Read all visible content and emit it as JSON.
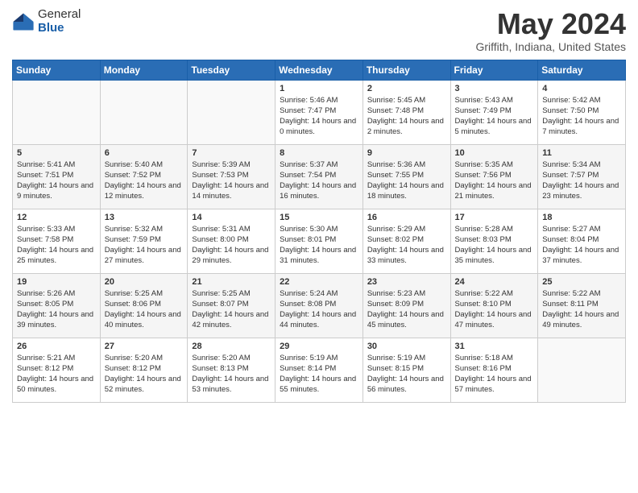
{
  "logo": {
    "general": "General",
    "blue": "Blue"
  },
  "title": "May 2024",
  "subtitle": "Griffith, Indiana, United States",
  "days_header": [
    "Sunday",
    "Monday",
    "Tuesday",
    "Wednesday",
    "Thursday",
    "Friday",
    "Saturday"
  ],
  "weeks": [
    [
      {
        "day": "",
        "sunrise": "",
        "sunset": "",
        "daylight": ""
      },
      {
        "day": "",
        "sunrise": "",
        "sunset": "",
        "daylight": ""
      },
      {
        "day": "",
        "sunrise": "",
        "sunset": "",
        "daylight": ""
      },
      {
        "day": "1",
        "sunrise": "Sunrise: 5:46 AM",
        "sunset": "Sunset: 7:47 PM",
        "daylight": "Daylight: 14 hours and 0 minutes."
      },
      {
        "day": "2",
        "sunrise": "Sunrise: 5:45 AM",
        "sunset": "Sunset: 7:48 PM",
        "daylight": "Daylight: 14 hours and 2 minutes."
      },
      {
        "day": "3",
        "sunrise": "Sunrise: 5:43 AM",
        "sunset": "Sunset: 7:49 PM",
        "daylight": "Daylight: 14 hours and 5 minutes."
      },
      {
        "day": "4",
        "sunrise": "Sunrise: 5:42 AM",
        "sunset": "Sunset: 7:50 PM",
        "daylight": "Daylight: 14 hours and 7 minutes."
      }
    ],
    [
      {
        "day": "5",
        "sunrise": "Sunrise: 5:41 AM",
        "sunset": "Sunset: 7:51 PM",
        "daylight": "Daylight: 14 hours and 9 minutes."
      },
      {
        "day": "6",
        "sunrise": "Sunrise: 5:40 AM",
        "sunset": "Sunset: 7:52 PM",
        "daylight": "Daylight: 14 hours and 12 minutes."
      },
      {
        "day": "7",
        "sunrise": "Sunrise: 5:39 AM",
        "sunset": "Sunset: 7:53 PM",
        "daylight": "Daylight: 14 hours and 14 minutes."
      },
      {
        "day": "8",
        "sunrise": "Sunrise: 5:37 AM",
        "sunset": "Sunset: 7:54 PM",
        "daylight": "Daylight: 14 hours and 16 minutes."
      },
      {
        "day": "9",
        "sunrise": "Sunrise: 5:36 AM",
        "sunset": "Sunset: 7:55 PM",
        "daylight": "Daylight: 14 hours and 18 minutes."
      },
      {
        "day": "10",
        "sunrise": "Sunrise: 5:35 AM",
        "sunset": "Sunset: 7:56 PM",
        "daylight": "Daylight: 14 hours and 21 minutes."
      },
      {
        "day": "11",
        "sunrise": "Sunrise: 5:34 AM",
        "sunset": "Sunset: 7:57 PM",
        "daylight": "Daylight: 14 hours and 23 minutes."
      }
    ],
    [
      {
        "day": "12",
        "sunrise": "Sunrise: 5:33 AM",
        "sunset": "Sunset: 7:58 PM",
        "daylight": "Daylight: 14 hours and 25 minutes."
      },
      {
        "day": "13",
        "sunrise": "Sunrise: 5:32 AM",
        "sunset": "Sunset: 7:59 PM",
        "daylight": "Daylight: 14 hours and 27 minutes."
      },
      {
        "day": "14",
        "sunrise": "Sunrise: 5:31 AM",
        "sunset": "Sunset: 8:00 PM",
        "daylight": "Daylight: 14 hours and 29 minutes."
      },
      {
        "day": "15",
        "sunrise": "Sunrise: 5:30 AM",
        "sunset": "Sunset: 8:01 PM",
        "daylight": "Daylight: 14 hours and 31 minutes."
      },
      {
        "day": "16",
        "sunrise": "Sunrise: 5:29 AM",
        "sunset": "Sunset: 8:02 PM",
        "daylight": "Daylight: 14 hours and 33 minutes."
      },
      {
        "day": "17",
        "sunrise": "Sunrise: 5:28 AM",
        "sunset": "Sunset: 8:03 PM",
        "daylight": "Daylight: 14 hours and 35 minutes."
      },
      {
        "day": "18",
        "sunrise": "Sunrise: 5:27 AM",
        "sunset": "Sunset: 8:04 PM",
        "daylight": "Daylight: 14 hours and 37 minutes."
      }
    ],
    [
      {
        "day": "19",
        "sunrise": "Sunrise: 5:26 AM",
        "sunset": "Sunset: 8:05 PM",
        "daylight": "Daylight: 14 hours and 39 minutes."
      },
      {
        "day": "20",
        "sunrise": "Sunrise: 5:25 AM",
        "sunset": "Sunset: 8:06 PM",
        "daylight": "Daylight: 14 hours and 40 minutes."
      },
      {
        "day": "21",
        "sunrise": "Sunrise: 5:25 AM",
        "sunset": "Sunset: 8:07 PM",
        "daylight": "Daylight: 14 hours and 42 minutes."
      },
      {
        "day": "22",
        "sunrise": "Sunrise: 5:24 AM",
        "sunset": "Sunset: 8:08 PM",
        "daylight": "Daylight: 14 hours and 44 minutes."
      },
      {
        "day": "23",
        "sunrise": "Sunrise: 5:23 AM",
        "sunset": "Sunset: 8:09 PM",
        "daylight": "Daylight: 14 hours and 45 minutes."
      },
      {
        "day": "24",
        "sunrise": "Sunrise: 5:22 AM",
        "sunset": "Sunset: 8:10 PM",
        "daylight": "Daylight: 14 hours and 47 minutes."
      },
      {
        "day": "25",
        "sunrise": "Sunrise: 5:22 AM",
        "sunset": "Sunset: 8:11 PM",
        "daylight": "Daylight: 14 hours and 49 minutes."
      }
    ],
    [
      {
        "day": "26",
        "sunrise": "Sunrise: 5:21 AM",
        "sunset": "Sunset: 8:12 PM",
        "daylight": "Daylight: 14 hours and 50 minutes."
      },
      {
        "day": "27",
        "sunrise": "Sunrise: 5:20 AM",
        "sunset": "Sunset: 8:12 PM",
        "daylight": "Daylight: 14 hours and 52 minutes."
      },
      {
        "day": "28",
        "sunrise": "Sunrise: 5:20 AM",
        "sunset": "Sunset: 8:13 PM",
        "daylight": "Daylight: 14 hours and 53 minutes."
      },
      {
        "day": "29",
        "sunrise": "Sunrise: 5:19 AM",
        "sunset": "Sunset: 8:14 PM",
        "daylight": "Daylight: 14 hours and 55 minutes."
      },
      {
        "day": "30",
        "sunrise": "Sunrise: 5:19 AM",
        "sunset": "Sunset: 8:15 PM",
        "daylight": "Daylight: 14 hours and 56 minutes."
      },
      {
        "day": "31",
        "sunrise": "Sunrise: 5:18 AM",
        "sunset": "Sunset: 8:16 PM",
        "daylight": "Daylight: 14 hours and 57 minutes."
      },
      {
        "day": "",
        "sunrise": "",
        "sunset": "",
        "daylight": ""
      }
    ]
  ]
}
